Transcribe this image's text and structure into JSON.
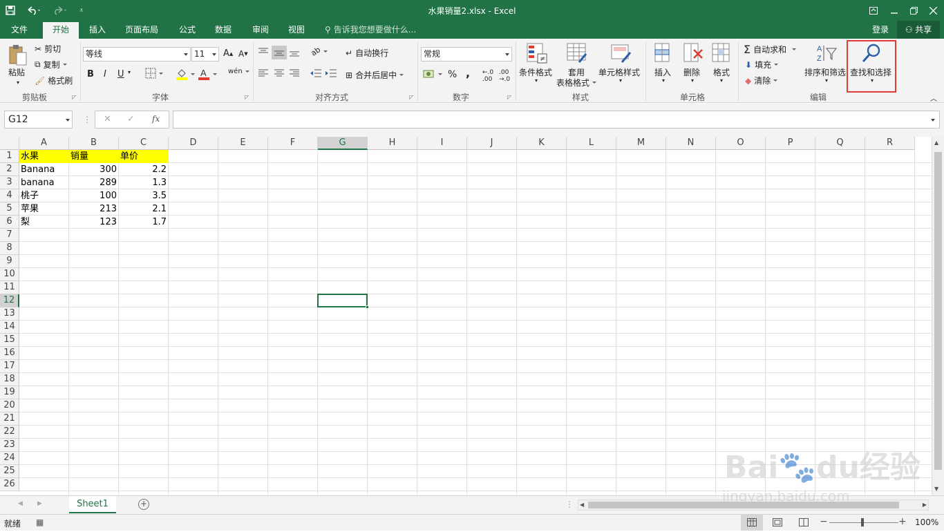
{
  "window": {
    "title": "水果销量2.xlsx - Excel"
  },
  "quick_access": {
    "save_icon": "save-icon",
    "undo_icon": "undo-icon",
    "redo_icon": "redo-icon"
  },
  "tabs": [
    {
      "label": "文件"
    },
    {
      "label": "开始",
      "active": true
    },
    {
      "label": "插入"
    },
    {
      "label": "页面布局"
    },
    {
      "label": "公式"
    },
    {
      "label": "数据"
    },
    {
      "label": "审阅"
    },
    {
      "label": "视图"
    }
  ],
  "tell_me": {
    "placeholder": "告诉我您想要做什么..."
  },
  "account": {
    "login": "登录",
    "share": "共享"
  },
  "ribbon": {
    "clipboard": {
      "paste": "粘贴",
      "cut": "剪切",
      "copy": "复制",
      "format_painter": "格式刷",
      "label": "剪贴板"
    },
    "font": {
      "name": "等线",
      "size": "11",
      "bold": "B",
      "italic": "I",
      "underline": "U",
      "label": "字体"
    },
    "alignment": {
      "wrap": "自动换行",
      "merge": "合并后居中",
      "label": "对齐方式"
    },
    "number": {
      "format": "常规",
      "percent": "%",
      "comma": ",",
      "label": "数字"
    },
    "styles": {
      "conditional": "条件格式",
      "table_line1": "套用",
      "table_line2": "表格格式",
      "cell_styles": "单元格样式",
      "label": "样式"
    },
    "cells": {
      "insert": "插入",
      "delete": "删除",
      "format": "格式",
      "label": "单元格"
    },
    "editing": {
      "autosum": "自动求和",
      "fill": "填充",
      "clear": "清除",
      "sort_filter": "排序和筛选",
      "find_select": "查找和选择",
      "label": "编辑"
    }
  },
  "formula_bar": {
    "name_box": "G12",
    "fx": "fx",
    "formula": ""
  },
  "columns": [
    "A",
    "B",
    "C",
    "D",
    "E",
    "F",
    "G",
    "H",
    "I",
    "J",
    "K",
    "L",
    "M",
    "N",
    "O",
    "P",
    "Q",
    "R"
  ],
  "rows": [
    "1",
    "2",
    "3",
    "4",
    "5",
    "6",
    "7",
    "8",
    "9",
    "10",
    "11",
    "12",
    "13",
    "14",
    "15",
    "16",
    "17",
    "18",
    "19",
    "20",
    "21",
    "22",
    "23",
    "24",
    "25",
    "26"
  ],
  "table": {
    "header": [
      "水果",
      "销量",
      "单价"
    ],
    "data": [
      [
        "Banana",
        "300",
        "2.2"
      ],
      [
        "banana",
        "289",
        "1.3"
      ],
      [
        "桃子",
        "100",
        "3.5"
      ],
      [
        "苹果",
        "213",
        "2.1"
      ],
      [
        "梨",
        "123",
        "1.7"
      ]
    ]
  },
  "selected_cell": "G12",
  "sheet_tabs": [
    {
      "label": "Sheet1",
      "active": true
    }
  ],
  "status": {
    "ready": "就绪",
    "zoom": "100%"
  },
  "watermark": {
    "line1": "Bai",
    "line1b": "du",
    "line1c": "经验",
    "line2": "jingyan.baidu.com"
  },
  "colors": {
    "excel_green": "#217346",
    "header_fill": "#ffff00",
    "highlight_red": "#e03c31"
  }
}
